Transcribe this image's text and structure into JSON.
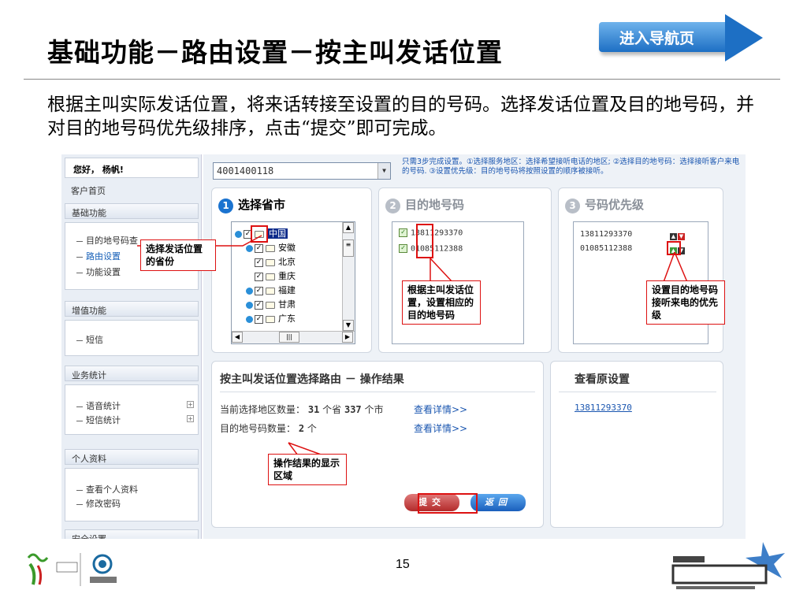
{
  "slide": {
    "title": "基础功能－路由设置－按主叫发话位置",
    "nav_button": "进入导航页",
    "intro": "根据主叫实际发话位置，将来话转接至设置的目的号码。选择发话位置及目的地号码，并对目的地号码优先级排序，点击“提交”即可完成。",
    "page_number": "15"
  },
  "sidebar": {
    "greeting": "您好， 杨帆!",
    "home": "客户首页",
    "sections": [
      {
        "header": "基础功能",
        "items": [
          "目的地号码查",
          "路由设置",
          "功能设置"
        ]
      },
      {
        "header": "增值功能",
        "items": [
          "短信"
        ]
      },
      {
        "header": "业务统计",
        "items": [
          "语音统计",
          "短信统计"
        ]
      },
      {
        "header": "个人资料",
        "items": [
          "查看个人资料",
          "修改密码"
        ]
      },
      {
        "header": "安全设置"
      }
    ]
  },
  "main": {
    "phone_number": "4001400118",
    "tip": "只需3步完成设置。①选择服务地区：选择希望接听电话的地区; ②选择目的地号码：选择接听客户来电的号码. ③设置优先级：目的地号码将按照设置的顺序被接听。",
    "steps": [
      {
        "num": "1",
        "title": "选择省市"
      },
      {
        "num": "2",
        "title": "目的地号码"
      },
      {
        "num": "3",
        "title": "号码优先级"
      }
    ],
    "tree": {
      "root": "中国",
      "provinces": [
        "安徽",
        "北京",
        "重庆",
        "福建",
        "甘肃",
        "广东"
      ]
    },
    "destination_numbers": [
      "13811293370",
      "01085112388"
    ],
    "priority_numbers": [
      "13811293370",
      "01085112388"
    ],
    "result": {
      "title": "按主叫发话位置选择路由 － 操作结果",
      "area_label": "当前选择地区数量：",
      "provinces_count": "31",
      "provinces_unit": "个省",
      "cities_count": "337",
      "cities_unit": "个市",
      "detail_link": "查看详情>>",
      "dest_label": "目的地号码数量：",
      "dest_count": "2",
      "dest_unit": "个"
    },
    "original": {
      "title": "查看原设置",
      "number": "13811293370"
    },
    "buttons": {
      "submit": "提交",
      "back": "返回"
    }
  },
  "annotations": {
    "province": "选择发话位置的省份",
    "destination": "根据主叫发话位置，设置相应的目的地号码",
    "priority": "设置目的地号码接听来电的优先级",
    "result_area": "操作结果的显示区域"
  },
  "colors": {
    "accent_blue": "#1a73d0",
    "annotation_red": "#dd1111",
    "link_blue": "#1a56b0"
  }
}
